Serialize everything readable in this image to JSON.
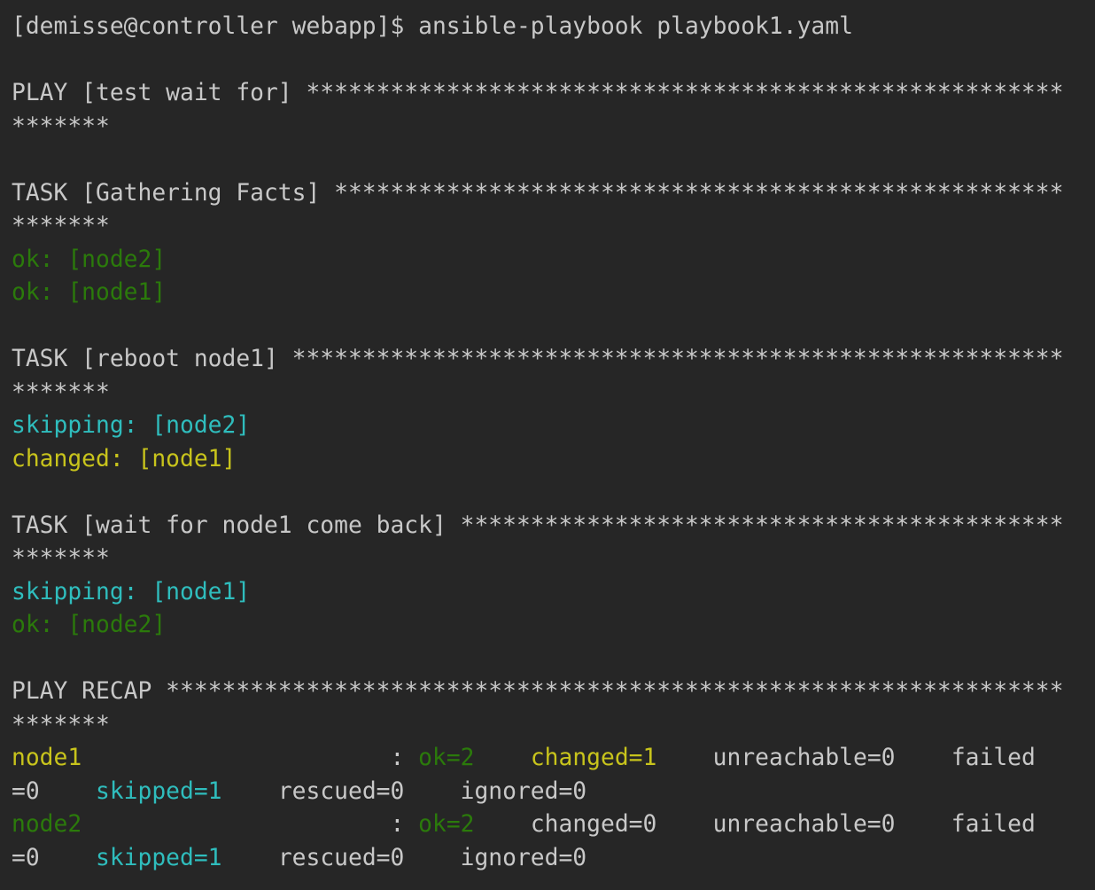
{
  "colors": {
    "background": "#262626",
    "default": "#c8c8c8",
    "green": "#2b7a0b",
    "cyan": "#2fbdbd",
    "yellow": "#c8c41c"
  },
  "terminal": {
    "lines": [
      [
        {
          "text": "[demisse@controller webapp]$ ansible-playbook playbook1.yaml",
          "color": "default"
        }
      ],
      [],
      [
        {
          "text": "PLAY [test wait for] ******************************************************",
          "color": "default"
        }
      ],
      [
        {
          "text": "*******",
          "color": "default"
        }
      ],
      [],
      [
        {
          "text": "TASK [Gathering Facts] ****************************************************",
          "color": "default"
        }
      ],
      [
        {
          "text": "*******",
          "color": "default"
        }
      ],
      [
        {
          "text": "ok: [node2]",
          "color": "green"
        }
      ],
      [
        {
          "text": "ok: [node1]",
          "color": "green"
        }
      ],
      [],
      [
        {
          "text": "TASK [reboot node1] *******************************************************",
          "color": "default"
        }
      ],
      [
        {
          "text": "*******",
          "color": "default"
        }
      ],
      [
        {
          "text": "skipping: [node2]",
          "color": "cyan"
        }
      ],
      [
        {
          "text": "changed: [node1]",
          "color": "yellow"
        }
      ],
      [],
      [
        {
          "text": "TASK [wait for node1 come back] *******************************************",
          "color": "default"
        }
      ],
      [
        {
          "text": "*******",
          "color": "default"
        }
      ],
      [
        {
          "text": "skipping: [node1]",
          "color": "cyan"
        }
      ],
      [
        {
          "text": "ok: [node2]",
          "color": "green"
        }
      ],
      [],
      [
        {
          "text": "PLAY RECAP ****************************************************************",
          "color": "default"
        }
      ],
      [
        {
          "text": "*******",
          "color": "default"
        }
      ],
      [
        {
          "text": "node1",
          "color": "yellow"
        },
        {
          "text": "                      : ",
          "color": "default"
        },
        {
          "text": "ok=2",
          "color": "green"
        },
        {
          "text": "    ",
          "color": "default"
        },
        {
          "text": "changed=1",
          "color": "yellow"
        },
        {
          "text": "    unreachable=0    failed",
          "color": "default"
        }
      ],
      [
        {
          "text": "=0    ",
          "color": "default"
        },
        {
          "text": "skipped=1",
          "color": "cyan"
        },
        {
          "text": "    rescued=0    ignored=0",
          "color": "default"
        }
      ],
      [
        {
          "text": "node2",
          "color": "green"
        },
        {
          "text": "                      : ",
          "color": "default"
        },
        {
          "text": "ok=2",
          "color": "green"
        },
        {
          "text": "    changed=0    unreachable=0    failed",
          "color": "default"
        }
      ],
      [
        {
          "text": "=0    ",
          "color": "default"
        },
        {
          "text": "skipped=1",
          "color": "cyan"
        },
        {
          "text": "    rescued=0    ignored=0",
          "color": "default"
        }
      ]
    ]
  }
}
